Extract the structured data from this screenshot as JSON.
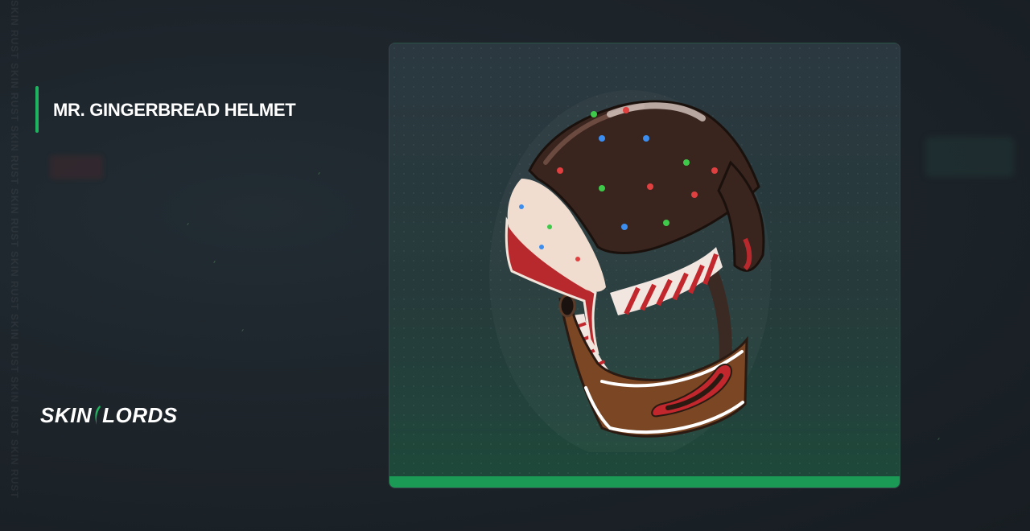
{
  "watermark": "SKIN RUST SKIN RUST SKIN RUST SKIN RUST SKIN RUST SKIN RUST SKIN RUST SKIN RUST",
  "item": {
    "title": "MR. GINGERBREAD HELMET"
  },
  "brand": {
    "name_left": "SKIN",
    "name_right": "LORDS"
  },
  "colors": {
    "accent": "#1fb35f",
    "card_bottom": "#1b9a55"
  },
  "icons": {
    "brand_mark": "leaf-slash-icon",
    "item_image": "gingerbread-helmet"
  }
}
